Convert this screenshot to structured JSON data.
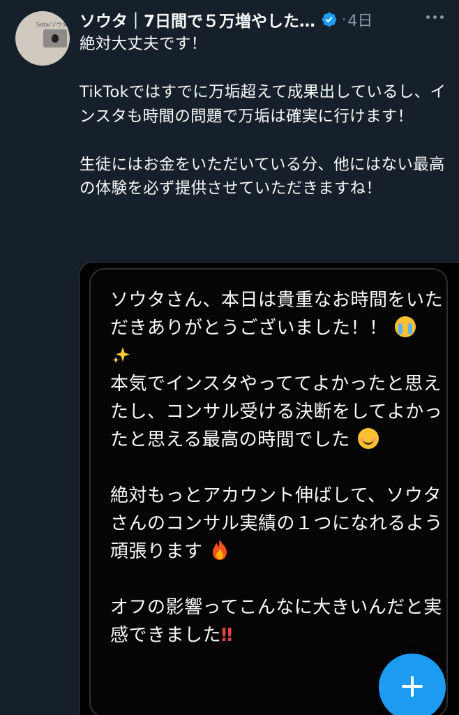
{
  "author": {
    "display_name": "ソウタ｜7日間で５万増やした…",
    "separator": "·",
    "time": "4日",
    "avatar_text": "Sota/ソウタ"
  },
  "tweet": {
    "line1": "絶対大丈夫です！",
    "para2": "TikTokではすでに万垢超えて成果出しているし、インスタも時間の問題で万垢は確実に行けます！",
    "para3": "生徒にはお金をいただいている分、他にはない最高の体験を必ず提供させていただきますね！"
  },
  "media": {
    "msg1": "ソウタさん、本日は貴重なお時間をいただきありがとうございました！！",
    "msg2": "本気でインスタやっててよかったと思えたし、コンサル受ける決断をしてよかったと思える最高の時間でした",
    "msg3": "絶対もっとアカウント伸ばして、ソウタさんのコンサル実績の１つになれるよう頑張ります",
    "msg4": "オフの影響ってこんなに大きいんだと実感できました",
    "msg4_suffix": "‼︎"
  },
  "icons": {
    "verified": "verified-badge-icon",
    "more": "more-options-icon",
    "compose": "compose-plus-icon"
  },
  "colors": {
    "background": "#15202b",
    "accent": "#1d9bf0",
    "secondary_text": "#8b98a5"
  }
}
